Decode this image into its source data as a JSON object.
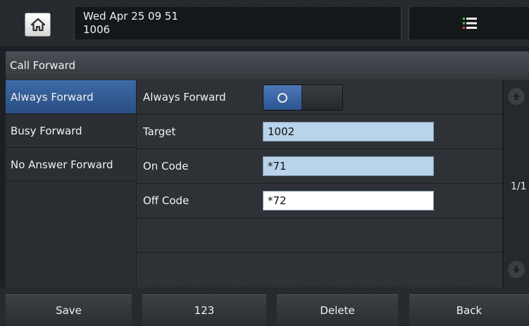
{
  "status_bar": {
    "datetime": "Wed Apr 25 09 51",
    "extension": "1006"
  },
  "icons": {
    "home": "home-icon",
    "menu": "menu-list-icon",
    "page_up": "arrow-up-icon",
    "page_down": "arrow-down-icon"
  },
  "title": "Call Forward",
  "sidebar": {
    "items": [
      {
        "label": "Always Forward",
        "active": true
      },
      {
        "label": "Busy Forward",
        "active": false
      },
      {
        "label": "No Answer Forward",
        "active": false
      }
    ]
  },
  "form": {
    "always_forward": {
      "label": "Always Forward",
      "enabled": false
    },
    "target": {
      "label": "Target",
      "value": "1002"
    },
    "on_code": {
      "label": "On Code",
      "value": "*71"
    },
    "off_code": {
      "label": "Off Code",
      "value": "*72"
    }
  },
  "pager": {
    "text": "1/1"
  },
  "softkeys": {
    "save": "Save",
    "num": "123",
    "delete": "Delete",
    "back": "Back"
  },
  "colors": {
    "accent": "#3d6aa8",
    "field_bg": "#b8d3ea",
    "menu_green": "#3bd14a",
    "menu_red": "#e0402f"
  }
}
